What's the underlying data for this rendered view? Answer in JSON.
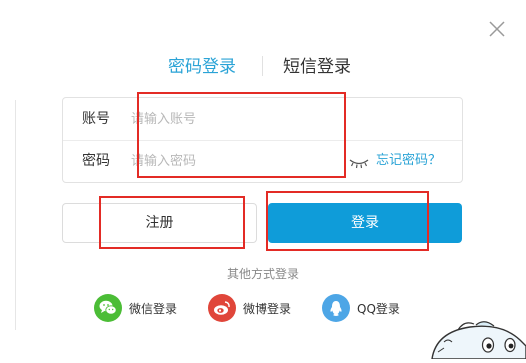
{
  "tabs": {
    "password_login": "密码登录",
    "sms_login": "短信登录"
  },
  "form": {
    "account_label": "账号",
    "account_placeholder": "请输入账号",
    "password_label": "密码",
    "password_placeholder": "请输入密码",
    "forgot_password": "忘记密码？"
  },
  "buttons": {
    "register": "注册",
    "login": "登录"
  },
  "other_login": {
    "title": "其他方式登录",
    "methods": [
      {
        "label": "微信登录",
        "icon": "wechat-icon"
      },
      {
        "label": "微博登录",
        "icon": "weibo-icon"
      },
      {
        "label": "QQ登录",
        "icon": "qq-icon"
      }
    ]
  },
  "colors": {
    "accent": "#2aa3d6",
    "login_button": "#0f9cd9",
    "annotation_red": "#e32b25",
    "wechat": "#4bbd36",
    "weibo": "#e0463a",
    "qq": "#4da6e6"
  }
}
